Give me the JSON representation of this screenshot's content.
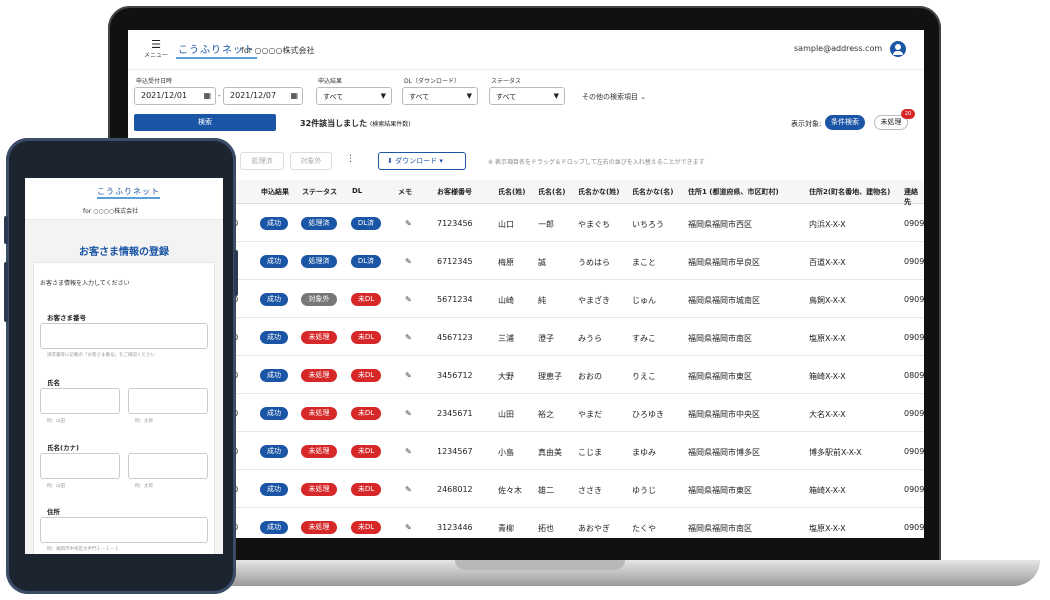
{
  "header": {
    "menu_label": "メニュー",
    "logo": "こうふりネット",
    "company": "for ○○○○株式会社",
    "email": "sample@address.com"
  },
  "filters": {
    "date_label": "申込受付日時",
    "date_from": "2021/12/01",
    "date_sep": "-",
    "date_to": "2021/12/07",
    "result_label": "申込結果",
    "result_value": "すべて",
    "dl_label": "DL（ダウンロード）",
    "dl_value": "すべて",
    "status_label": "ステータス",
    "status_value": "すべて",
    "more_label": "その他の検索項目"
  },
  "search": {
    "button": "検索",
    "count": "32件該当しました",
    "count_sub": "(検索結果件数)",
    "display_label": "表示対象:",
    "display_active": "条件検索",
    "display_other": "未処理",
    "badge": "20"
  },
  "toolbar": {
    "processed": "処理済",
    "excluded": "対象外",
    "download": "ダウンロード",
    "hint": "※ 表示項目名をドラッグ＆ドロップして左右の並びを入れ替えることができます"
  },
  "columns": [
    "申込結果",
    "ステータス",
    "DL",
    "メモ",
    "お客様番号",
    "氏名(姓)",
    "氏名(名)",
    "氏名かな(姓)",
    "氏名かな(名)",
    "住所1 (都道府県、市区町村)",
    "住所2(町名番地、建物名)",
    "連絡先"
  ],
  "rows": [
    {
      "time": "00",
      "result": "成功",
      "status": "処理済",
      "dl": "DL済",
      "no": "7123456",
      "last": "山口",
      "first": "一郎",
      "klast": "やまぐち",
      "kfirst": "いちろう",
      "addr1": "福岡県福岡市西区",
      "addr2": "内浜X-X-X",
      "tel": "0909"
    },
    {
      "time": "00",
      "result": "成功",
      "status": "処理済",
      "dl": "DL済",
      "no": "6712345",
      "last": "梅原",
      "first": "誠",
      "klast": "うめはら",
      "kfirst": "まこと",
      "addr1": "福岡県福岡市早良区",
      "addr2": "百道X-X-X",
      "tel": "0909"
    },
    {
      "time": "00",
      "result": "成功",
      "status": "対象外",
      "dl": "未DL",
      "no": "5671234",
      "last": "山崎",
      "first": "純",
      "klast": "やまざき",
      "kfirst": "じゅん",
      "addr1": "福岡県福岡市城南区",
      "addr2": "鳥飼X-X-X",
      "tel": "0909"
    },
    {
      "time": "00",
      "result": "成功",
      "status": "未処理",
      "dl": "未DL",
      "no": "4567123",
      "last": "三浦",
      "first": "澄子",
      "klast": "みうら",
      "kfirst": "すみこ",
      "addr1": "福岡県福岡市南区",
      "addr2": "塩原X-X-X",
      "tel": "0909"
    },
    {
      "time": "00",
      "result": "成功",
      "status": "未処理",
      "dl": "未DL",
      "no": "3456712",
      "last": "大野",
      "first": "理恵子",
      "klast": "おおの",
      "kfirst": "りえこ",
      "addr1": "福岡県福岡市東区",
      "addr2": "箱崎X-X-X",
      "tel": "0809"
    },
    {
      "time": "00",
      "result": "成功",
      "status": "未処理",
      "dl": "未DL",
      "no": "2345671",
      "last": "山田",
      "first": "裕之",
      "klast": "やまだ",
      "kfirst": "ひろゆき",
      "addr1": "福岡県福岡市中央区",
      "addr2": "大名X-X-X",
      "tel": "0909"
    },
    {
      "time": "00",
      "result": "成功",
      "status": "未処理",
      "dl": "未DL",
      "no": "1234567",
      "last": "小島",
      "first": "真由美",
      "klast": "こじま",
      "kfirst": "まゆみ",
      "addr1": "福岡県福岡市博多区",
      "addr2": "博多駅前X-X-X",
      "tel": "0909"
    },
    {
      "time": "00",
      "result": "成功",
      "status": "未処理",
      "dl": "未DL",
      "no": "2468012",
      "last": "佐々木",
      "first": "雄二",
      "klast": "ささき",
      "kfirst": "ゆうじ",
      "addr1": "福岡県福岡市東区",
      "addr2": "箱崎X-X-X",
      "tel": "0909"
    },
    {
      "time": "00",
      "result": "成功",
      "status": "未処理",
      "dl": "未DL",
      "no": "3123446",
      "last": "青柳",
      "first": "拓也",
      "klast": "あおやぎ",
      "kfirst": "たくや",
      "addr1": "福岡県福岡市南区",
      "addr2": "塩原X-X-X",
      "tel": "0909"
    }
  ],
  "colors": {
    "primary": "#1b55a5",
    "danger": "#d62828",
    "muted": "#777777"
  },
  "phone": {
    "logo": "こうふりネット",
    "company": "for ○○○○株式会社",
    "title": "お客さま情報の登録",
    "intro": "お客さま情報を入力してください",
    "customer_no_label": "お客さま番号",
    "customer_no_hint": "請求書等に記載の「お客さま番号」をご確認ください",
    "name_label": "氏名",
    "name_hint_last": "例：山田",
    "name_hint_first": "例：太郎",
    "kana_label": "氏名(カナ)",
    "kana_hint_last": "例：山田",
    "kana_hint_first": "例：太郎",
    "address_label": "住所",
    "address_hint": "例：福岡市中央区大手門１－１－１"
  }
}
